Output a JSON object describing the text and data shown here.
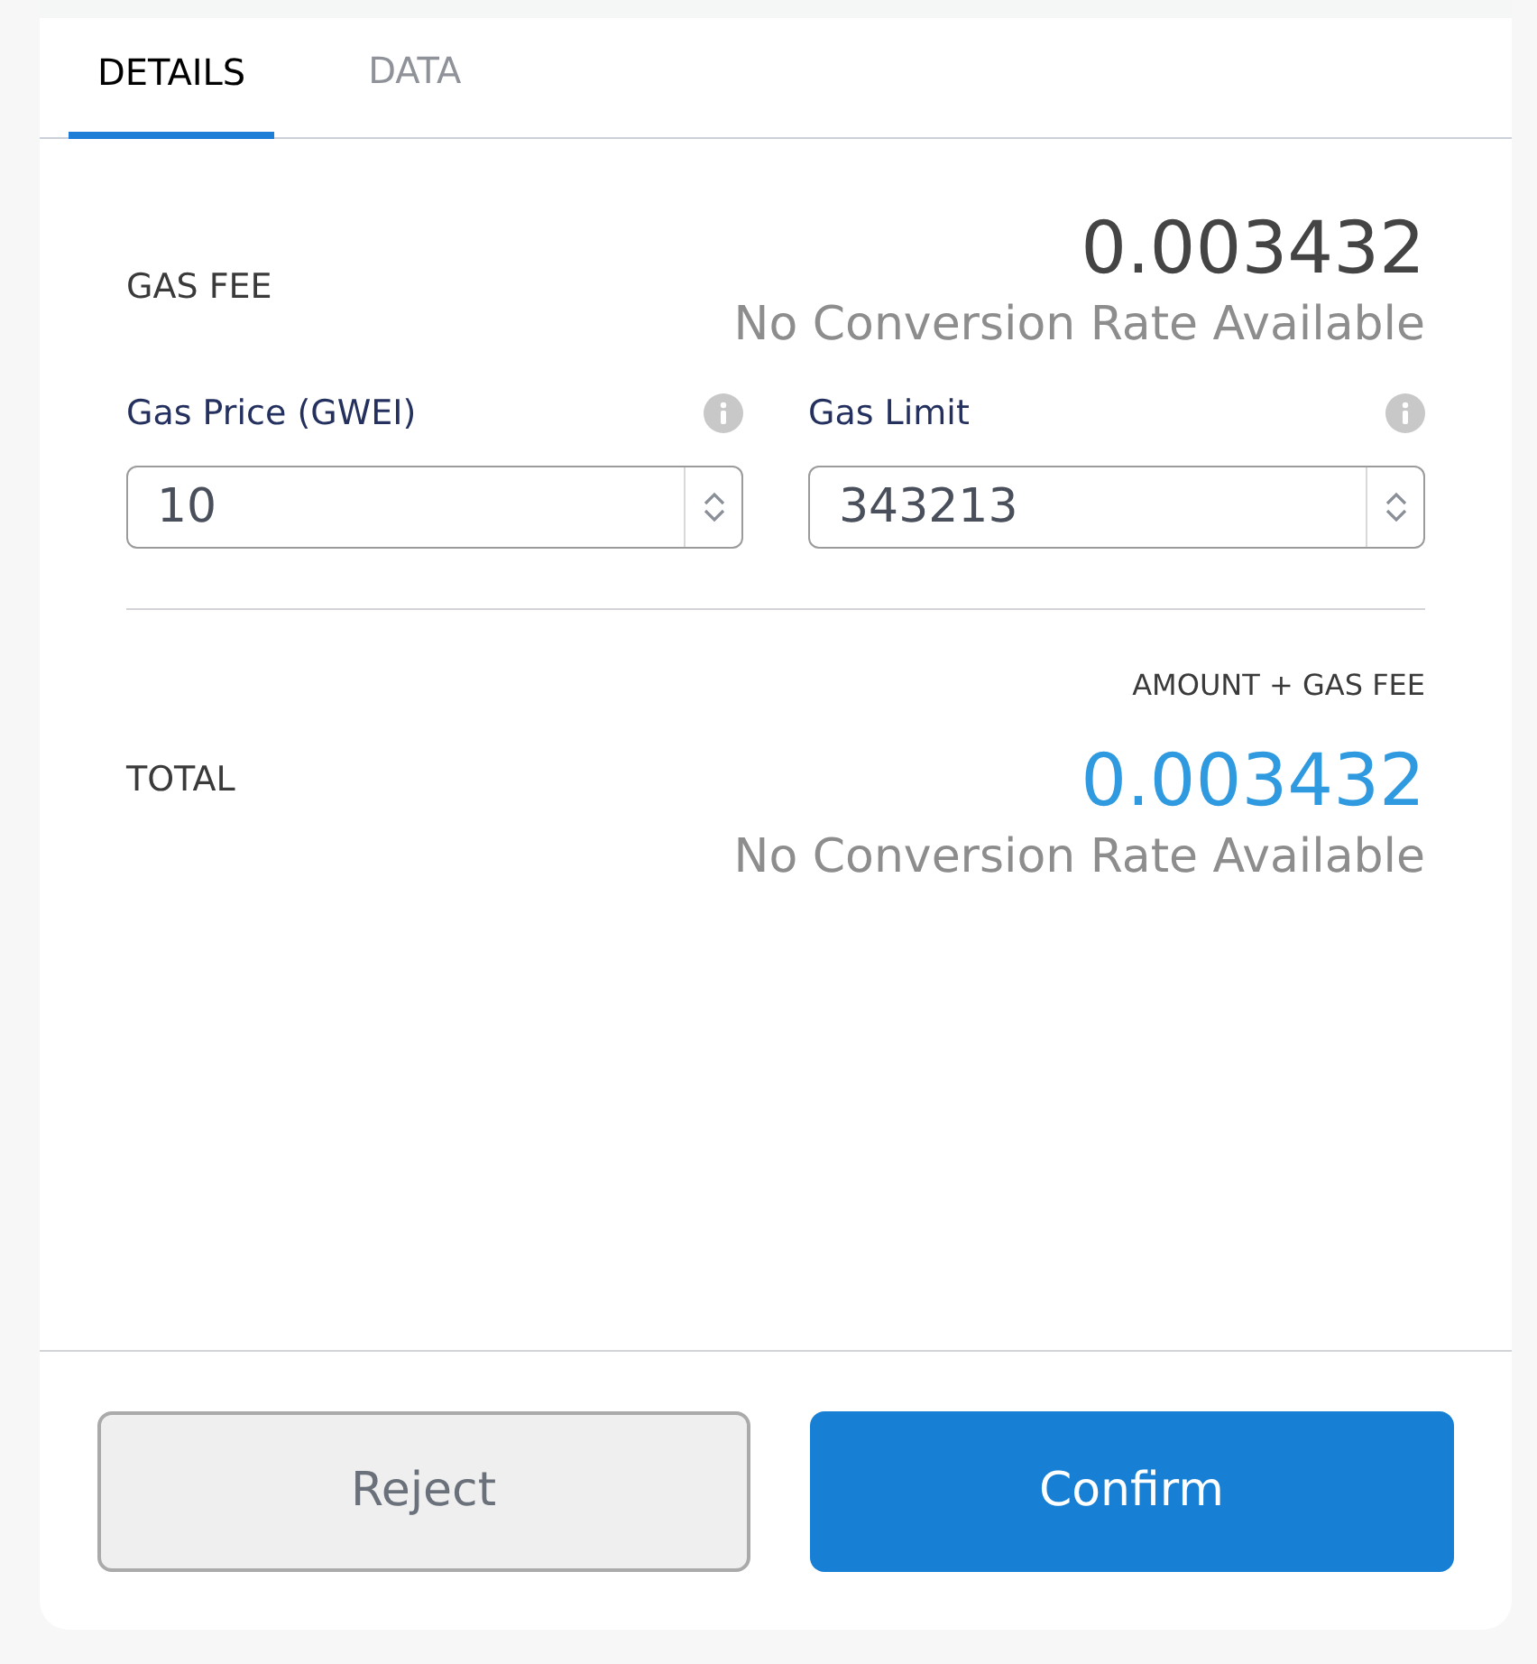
{
  "tabs": [
    {
      "label": "DETAILS",
      "selected": true
    },
    {
      "label": "DATA",
      "selected": false
    }
  ],
  "gas_fee": {
    "label": "GAS FEE",
    "amount": "0.003432",
    "conversion": "No Conversion Rate Available"
  },
  "fields": [
    {
      "label": "Gas Price (GWEI)",
      "value": "10"
    },
    {
      "label": "Gas Limit",
      "value": "343213"
    }
  ],
  "total": {
    "caption": "AMOUNT + GAS FEE",
    "label": "TOTAL",
    "amount": "0.003432",
    "conversion": "No Conversion Rate Available"
  },
  "buttons": [
    {
      "label": "Reject",
      "kind": "secondary"
    },
    {
      "label": "Confirm",
      "kind": "primary"
    }
  ]
}
